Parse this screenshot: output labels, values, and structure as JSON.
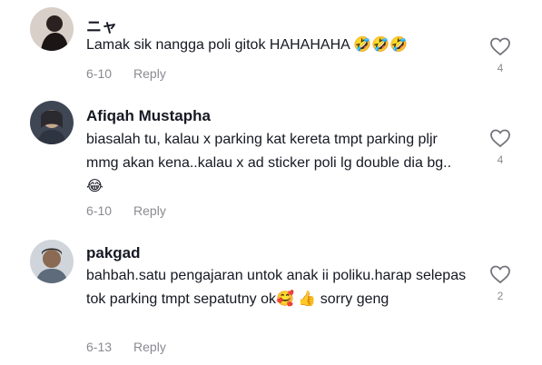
{
  "comments": [
    {
      "username": "ニャ",
      "text": "Lamak sik nangga poli gitok HAHAHAHA 🤣🤣🤣",
      "date": "6-10",
      "reply_label": "Reply",
      "likes": "4"
    },
    {
      "username": "Afiqah Mustapha",
      "text": "biasalah tu, kalau x parking kat kereta tmpt parking pljr mmg akan kena..kalau x ad sticker poli lg double dia bg..😂",
      "date": "6-10",
      "reply_label": "Reply",
      "likes": "4"
    },
    {
      "username": "pakgad",
      "text": "bahbah.satu pengajaran untok anak ii poliku.harap selepas tok parking tmpt sepatutny ok🥰 👍 sorry geng",
      "date": "6-13",
      "reply_label": "Reply",
      "likes": "2"
    }
  ]
}
